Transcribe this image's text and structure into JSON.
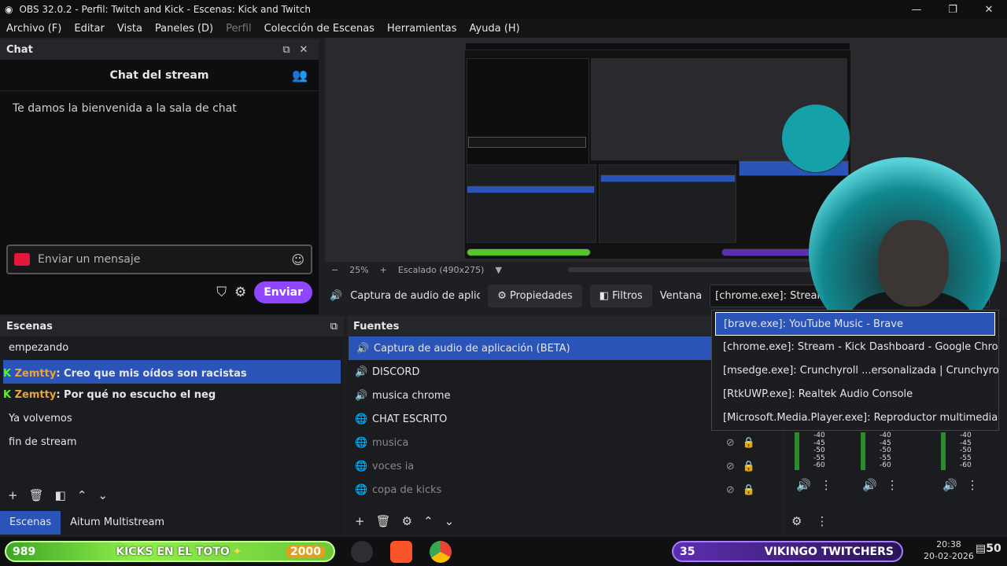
{
  "window": {
    "title": "OBS 32.0.2 - Perfil: Twitch and Kick - Escenas: Kick and Twitch",
    "min": "—",
    "max": "❐",
    "close": "✕"
  },
  "menu": [
    "Archivo (F)",
    "Editar",
    "Vista",
    "Paneles (D)",
    "Perfil",
    "Colección de Escenas",
    "Herramientas",
    "Ayuda (H)"
  ],
  "chat": {
    "dock_title": "Chat",
    "header": "Chat del stream",
    "welcome": "Te damos la bienvenida a la sala de chat",
    "input_placeholder": "Enviar un mensaje",
    "send_label": "Enviar"
  },
  "preview": {
    "zoom": "25%",
    "scale": "Escalado (490x275)"
  },
  "source_toolbar": {
    "current_source": "Captura de audio de aplicación (BETA)",
    "properties": "Propiedades",
    "filters": "Filtros",
    "window_label": "Ventana",
    "window_value": "[chrome.exe]: Stream - Kick Dashboard - Google Chrome"
  },
  "window_options": [
    "[brave.exe]: YouTube Music - Brave",
    "[chrome.exe]: Stream - Kick Dashboard - Google Chrome",
    "[msedge.exe]: Crunchyroll ...ersonalizada | Crunchyroll",
    "[RtkUWP.exe]: Realtek Audio Console",
    "[Microsoft.Media.Player.exe]: Reproductor multimedia"
  ],
  "scenes": {
    "title": "Escenas",
    "items": [
      "empezando",
      "",
      "",
      "Ya volvemos",
      "fin de stream"
    ],
    "chat_overlay": [
      {
        "user": "Zemtty",
        "msg": ": Creo que mis oídos son racistas"
      },
      {
        "user": "Zemtty",
        "msg": ": Por qué no escucho el neg"
      }
    ],
    "tabs": [
      "Escenas",
      "Aitum Multistream"
    ]
  },
  "sources": {
    "title": "Fuentes",
    "items": [
      {
        "name": "Captura de audio de aplicación (BETA)",
        "icon": "speaker-icon",
        "selected": true
      },
      {
        "name": "DISCORD",
        "icon": "speaker-icon"
      },
      {
        "name": "musica chrome",
        "icon": "speaker-icon"
      },
      {
        "name": "CHAT ESCRITO",
        "icon": "globe-icon"
      },
      {
        "name": "musica",
        "icon": "globe-icon",
        "hidden": true
      },
      {
        "name": "voces ia",
        "icon": "globe-icon",
        "hidden": true
      },
      {
        "name": "copa de kicks",
        "icon": "globe-icon",
        "hidden": true
      }
    ]
  },
  "mixer": {
    "db_ticks": [
      "-40",
      "-45",
      "-50",
      "-55",
      "-60"
    ]
  },
  "taskbar": {
    "kick_count": "989",
    "kick_text": "KICKS EN EL TOTO",
    "kick_goal": "2000",
    "twitch_count": "35",
    "twitch_text": "VIKINGO TWITCHERS",
    "time": "20:38",
    "date": "20-02-2026",
    "notifications": "50"
  }
}
